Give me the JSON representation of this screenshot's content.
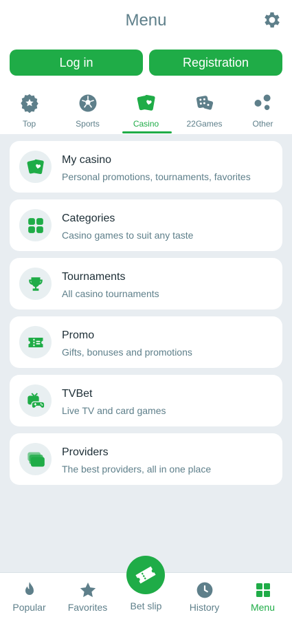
{
  "header": {
    "title": "Menu",
    "settings_icon": "gear-icon"
  },
  "auth": {
    "login_label": "Log in",
    "registration_label": "Registration"
  },
  "categories": [
    {
      "label": "Top",
      "icon": "badge-star-icon"
    },
    {
      "label": "Sports",
      "icon": "soccer-ball-icon"
    },
    {
      "label": "Casino",
      "icon": "cards-icon",
      "active": true
    },
    {
      "label": "22Games",
      "icon": "dice-icon"
    },
    {
      "label": "Other",
      "icon": "dots-icon"
    }
  ],
  "items": [
    {
      "title": "My casino",
      "subtitle": "Personal promotions, tournaments, favorites",
      "icon": "cards-icon"
    },
    {
      "title": "Categories",
      "subtitle": "Casino games to suit any taste",
      "icon": "grid-icon"
    },
    {
      "title": "Tournaments",
      "subtitle": "All casino tournaments",
      "icon": "trophy-icon"
    },
    {
      "title": "Promo",
      "subtitle": "Gifts, bonuses and promotions",
      "icon": "ticket-icon"
    },
    {
      "title": "TVBet",
      "subtitle": "Live TV and card games",
      "icon": "tv-gamepad-icon"
    },
    {
      "title": "Providers",
      "subtitle": "The best providers, all in one place",
      "icon": "stack-icon"
    }
  ],
  "bottom_nav": [
    {
      "label": "Popular",
      "icon": "flame-icon"
    },
    {
      "label": "Favorites",
      "icon": "star-icon"
    },
    {
      "label": "Bet slip",
      "icon": "ticket-icon"
    },
    {
      "label": "History",
      "icon": "clock-icon"
    },
    {
      "label": "Menu",
      "icon": "grid-icon",
      "active": true
    }
  ],
  "colors": {
    "accent": "#1fac47",
    "muted": "#5e7f8a",
    "text": "#1c2d35",
    "background": "#e8edf1"
  }
}
